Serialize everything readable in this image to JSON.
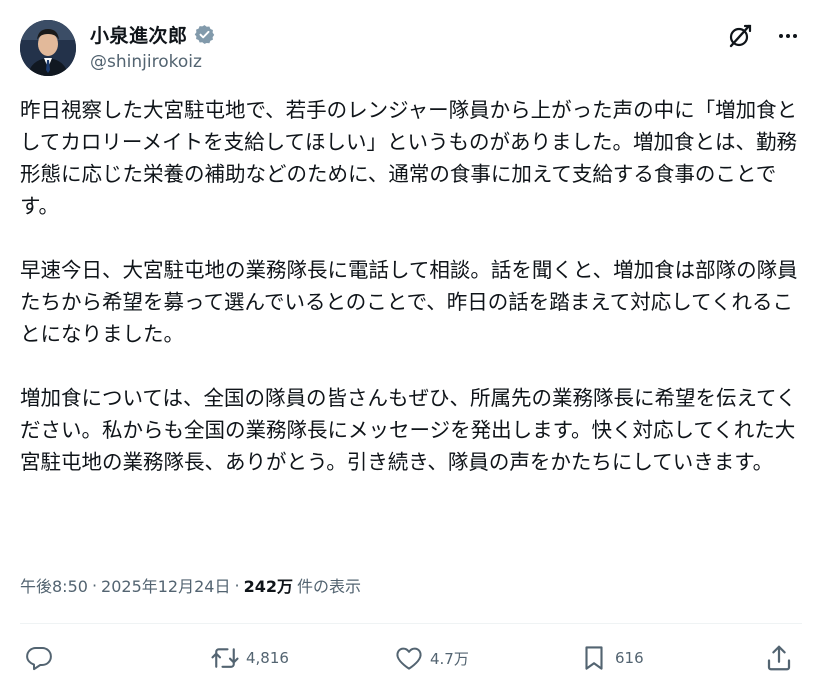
{
  "author": {
    "display_name": "小泉進次郎",
    "handle": "@shinjirokoiz",
    "verified": true
  },
  "post": {
    "paragraphs": [
      "昨日視察した大宮駐屯地で、若手のレンジャー隊員から上がった声の中に「増加食としてカロリーメイトを支給してほしい」というものがありました。増加食とは、勤務形態に応じた栄養の補助などのために、通常の食事に加えて支給する食事のことです。",
      "早速今日、大宮駐屯地の業務隊長に電話して相談。話を聞くと、増加食は部隊の隊員たちから希望を募って選んでいるとのことで、昨日の話を踏まえて対応してくれることになりました。",
      "増加食については、全国の隊員の皆さんもぜひ、所属先の業務隊長に希望を伝えてください。私からも全国の業務隊長にメッセージを発出します。快く対応してくれた大宮駐屯地の業務隊長、ありがとう。引き続き、隊員の声をかたちにしていきます。"
    ]
  },
  "meta": {
    "time": "午後8:50",
    "separator": "·",
    "date": "2025年12月24日",
    "views_count": "242万",
    "views_label": "件の表示"
  },
  "actions": {
    "replies": "",
    "reposts": "4,816",
    "likes": "4.7万",
    "bookmarks": "616"
  },
  "icons": {
    "verified": "verified-badge-icon",
    "grok": "grok-icon",
    "more": "more-icon",
    "reply": "reply-icon",
    "repost": "repost-icon",
    "like": "heart-icon",
    "bookmark": "bookmark-icon",
    "share": "share-icon"
  },
  "colors": {
    "text_primary": "#0f1419",
    "text_secondary": "#536471",
    "verified_badge": "#829aab",
    "divider": "#eff3f4"
  }
}
